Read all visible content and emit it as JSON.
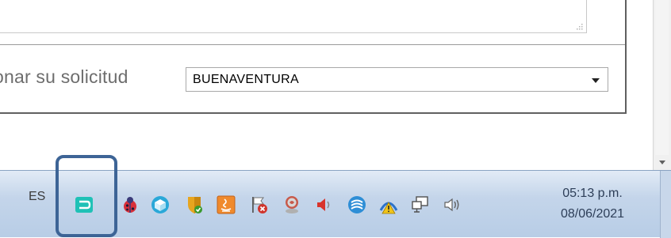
{
  "form": {
    "label_partial": "onar su solicitud",
    "select_value": "BUENAVENTURA"
  },
  "taskbar": {
    "language": "ES",
    "time": "05:13 p.m.",
    "date": "08/06/2021",
    "tray_icons": [
      "app-u-icon",
      "ladybug-icon",
      "cube-icon",
      "shield-check-icon",
      "java-icon",
      "action-center-flag-icon",
      "user-icon",
      "speaker-muted-icon",
      "wireless-icon",
      "network-warning-icon",
      "network-computer-icon",
      "volume-icon"
    ]
  },
  "colors": {
    "highlight": "#3d6496",
    "taskbar": "#c4d5ea",
    "app_u_icon": "#1fc1b6"
  }
}
